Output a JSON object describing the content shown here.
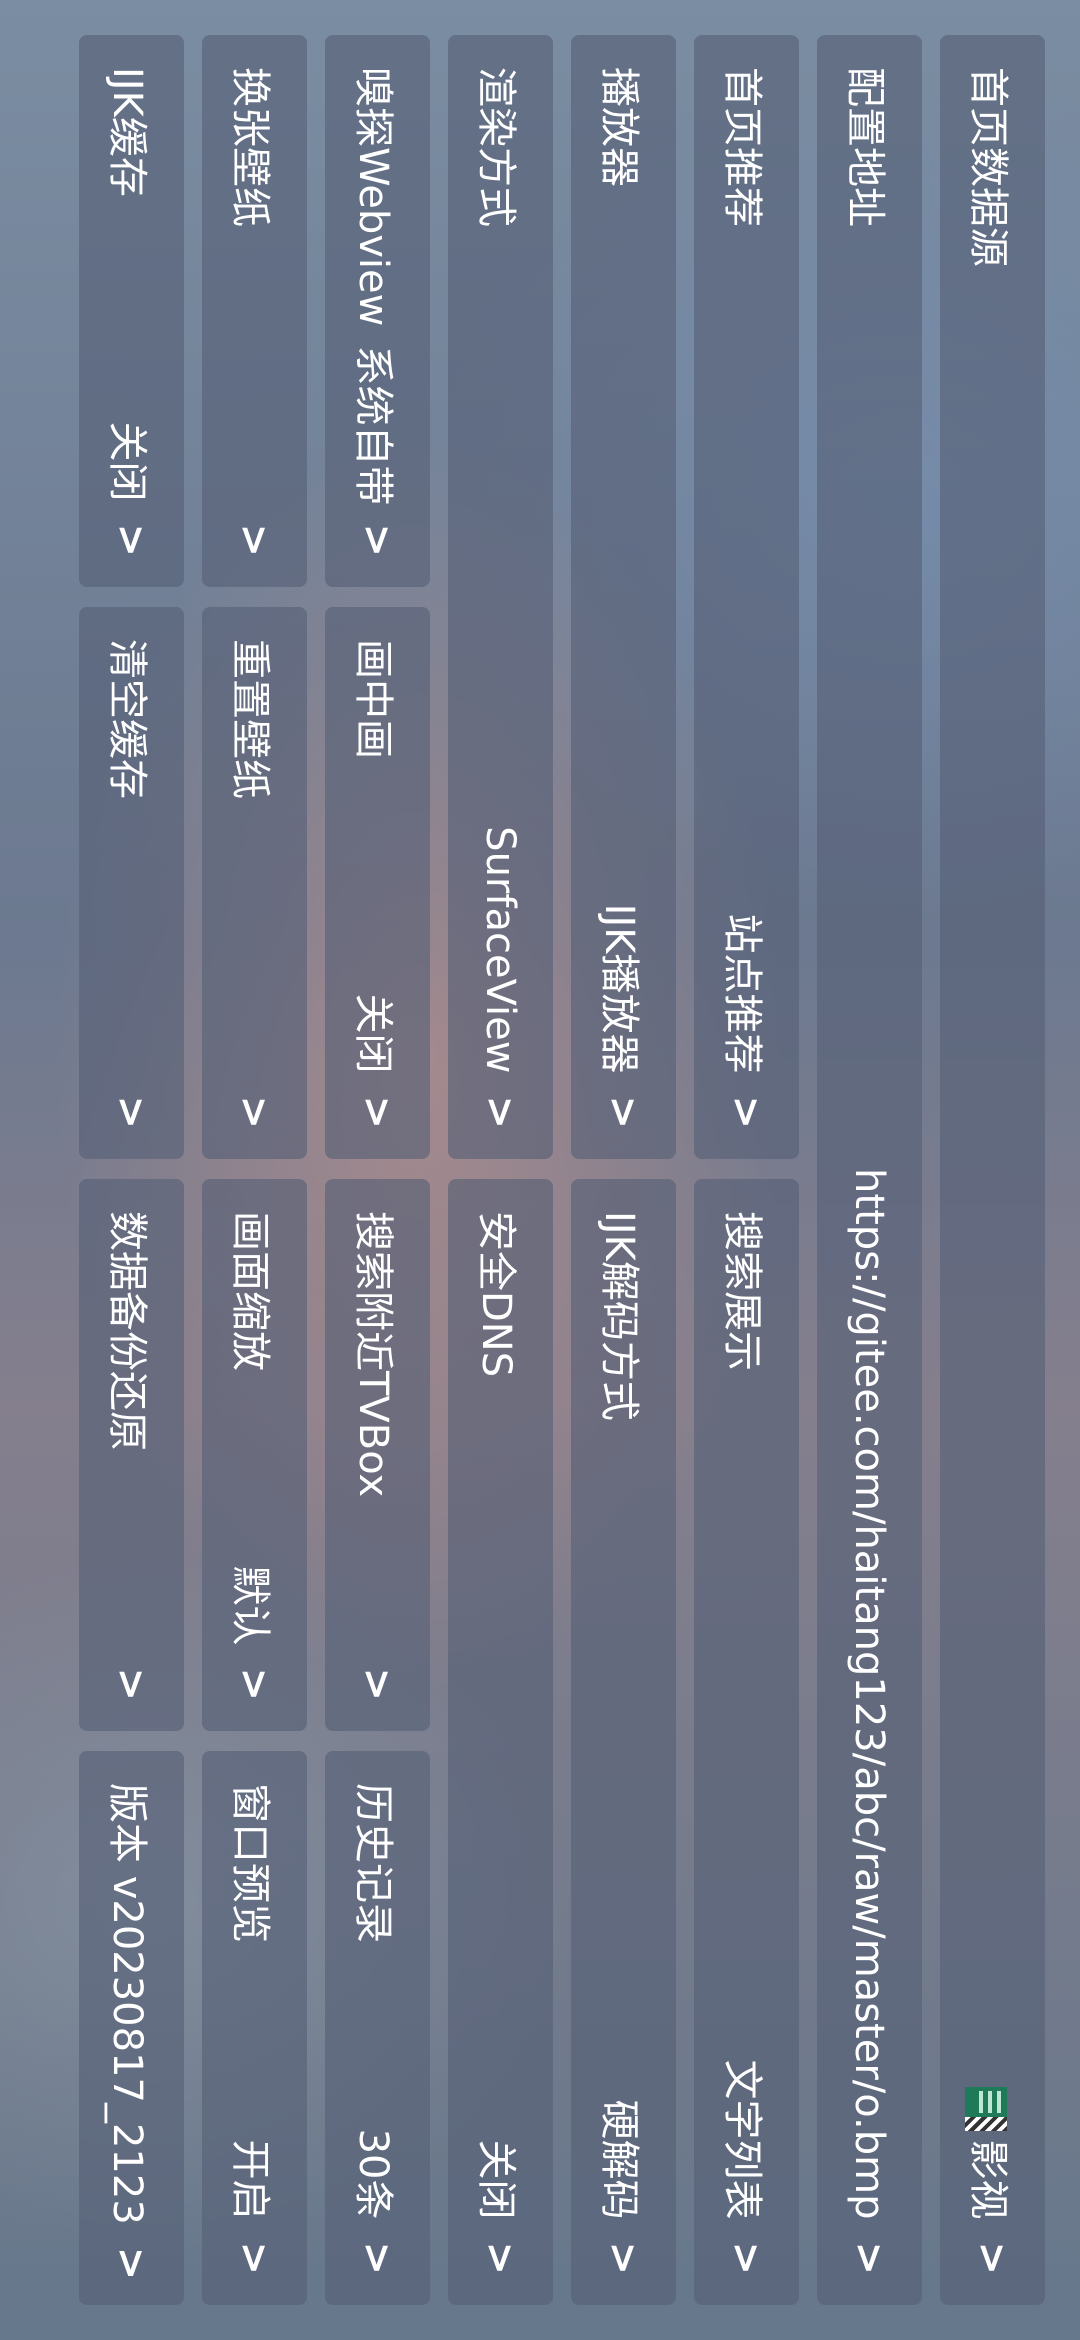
{
  "rows": [
    {
      "full": {
        "label": "首页数据源",
        "value": "影视",
        "icon": "site-icon",
        "chevron": ">"
      }
    },
    {
      "full": {
        "label": "配置地址",
        "value": "https://gitee.com/haitang123/abc/raw/master/o.bmp",
        "chevron": ">"
      }
    },
    {
      "c1": {
        "label": "首页推荐",
        "value": "",
        "chevron": ""
      },
      "c2": {
        "label": "",
        "value": "站点推荐",
        "chevron": ">"
      },
      "c3": {
        "label": "搜索展示",
        "value": "",
        "chevron": ""
      },
      "c4": {
        "label": "",
        "value": "文字列表",
        "chevron": ">"
      }
    },
    {
      "c1": {
        "label": "播放器",
        "value": "",
        "chevron": ""
      },
      "c2": {
        "label": "",
        "value": "IJK播放器",
        "chevron": ">"
      },
      "c3": {
        "label": "IJK解码方式",
        "value": "",
        "chevron": ""
      },
      "c4": {
        "label": "",
        "value": "硬解码",
        "chevron": ">"
      }
    },
    {
      "c1": {
        "label": "渲染方式",
        "value": "",
        "chevron": ""
      },
      "c2": {
        "label": "",
        "value": "SurfaceView",
        "chevron": ">"
      },
      "c3": {
        "label": "安全DNS",
        "value": "",
        "chevron": ""
      },
      "c4": {
        "label": "",
        "value": "关闭",
        "chevron": ">"
      }
    },
    {
      "c1": {
        "label": "嗅探Webview",
        "value": "系统自带",
        "chevron": ">"
      },
      "c2": {
        "label": "画中画",
        "value": "关闭",
        "chevron": ">"
      },
      "c3": {
        "label": "搜索附近TVBox",
        "value": "",
        "chevron": ">"
      },
      "c4": {
        "label": "历史记录",
        "value": "30条",
        "chevron": ">"
      }
    },
    {
      "c1": {
        "label": "换张壁纸",
        "value": "",
        "chevron": ">"
      },
      "c2": {
        "label": "重置壁纸",
        "value": "",
        "chevron": ">"
      },
      "c3": {
        "label": "画面缩放",
        "value": "默认",
        "chevron": ">"
      },
      "c4": {
        "label": "窗口预览",
        "value": "开启",
        "chevron": ">"
      }
    },
    {
      "c1": {
        "label": "IJK缓存",
        "value": "关闭",
        "chevron": ">"
      },
      "c2": {
        "label": "清空缓存",
        "value": "",
        "chevron": ">"
      },
      "c3": {
        "label": "数据备份还原",
        "value": "",
        "chevron": ">"
      },
      "c4": {
        "label": "版本 v20230817_2123",
        "value": "",
        "chevron": ">"
      }
    }
  ]
}
